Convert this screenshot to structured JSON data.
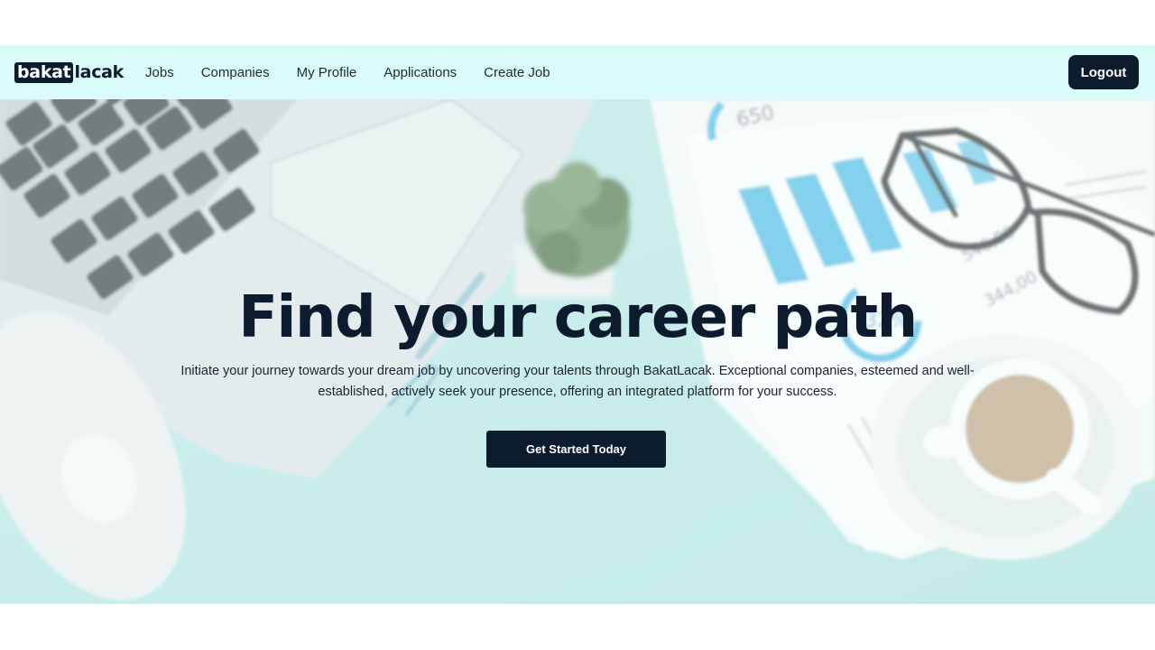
{
  "navbar": {
    "logo_box_text": "bakat",
    "logo_rest_text": "lacak",
    "links": [
      "Jobs",
      "Companies",
      "My Profile",
      "Applications",
      "Create Job"
    ],
    "logout_label": "Logout"
  },
  "hero": {
    "title": "Find your career path",
    "description": "Initiate your journey towards your dream job by uncovering your talents through BakatLacak. Exceptional companies, esteemed and well-established, actively seek your presence, offering an integrated platform for your success.",
    "cta_label": "Get Started Today",
    "background_texts": {
      "paper_top": "650",
      "price_1": "546,00",
      "price_2": "344,00",
      "percent": "32%"
    }
  },
  "colors": {
    "navbar_bg": "#dafcf8",
    "primary_dark": "#0c1c2e",
    "hero_bg": "#bfe9e6",
    "chart_blue": "#5fc3ea"
  }
}
